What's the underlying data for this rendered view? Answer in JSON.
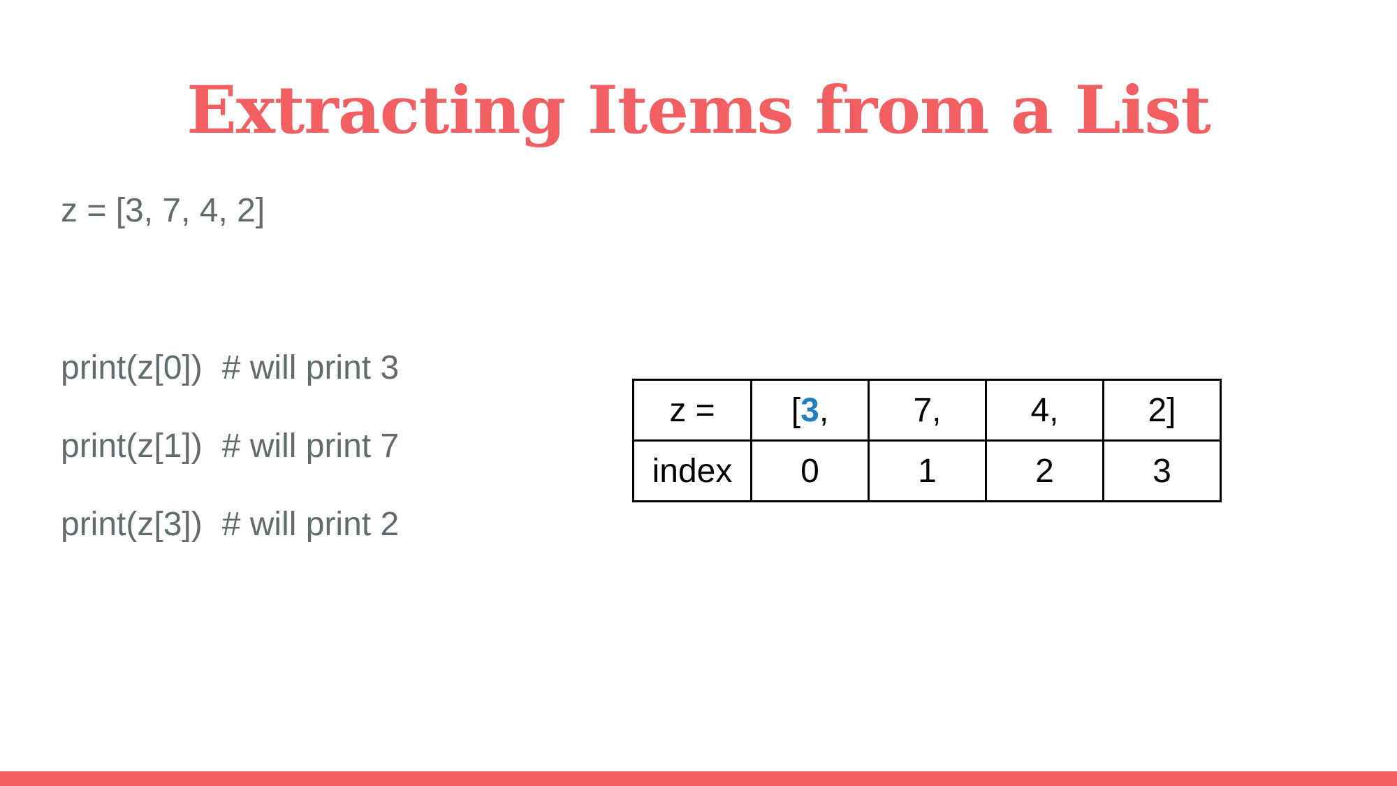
{
  "slide": {
    "title": "Extracting Items from a List",
    "list_definition": "z = [3, 7, 4, 2]",
    "code_lines": [
      {
        "code": "print(z[0])",
        "comment": "# will print 3"
      },
      {
        "code": "print(z[1])",
        "comment": "# will print 7"
      },
      {
        "code": "print(z[3])",
        "comment": "# will print 2"
      }
    ]
  },
  "table": {
    "row1": {
      "label": "z =",
      "cell0_bracket": "[",
      "cell0_value": "3",
      "cell0_suffix": ",",
      "cell1": "7,",
      "cell2": "4,",
      "cell3": "2]"
    },
    "row2": {
      "label": "index",
      "cells": [
        "0",
        "1",
        "2",
        "3"
      ]
    }
  },
  "colors": {
    "accent": "#f25f62",
    "body_text": "#5f6b6d",
    "highlight": "#1f7fc0"
  }
}
